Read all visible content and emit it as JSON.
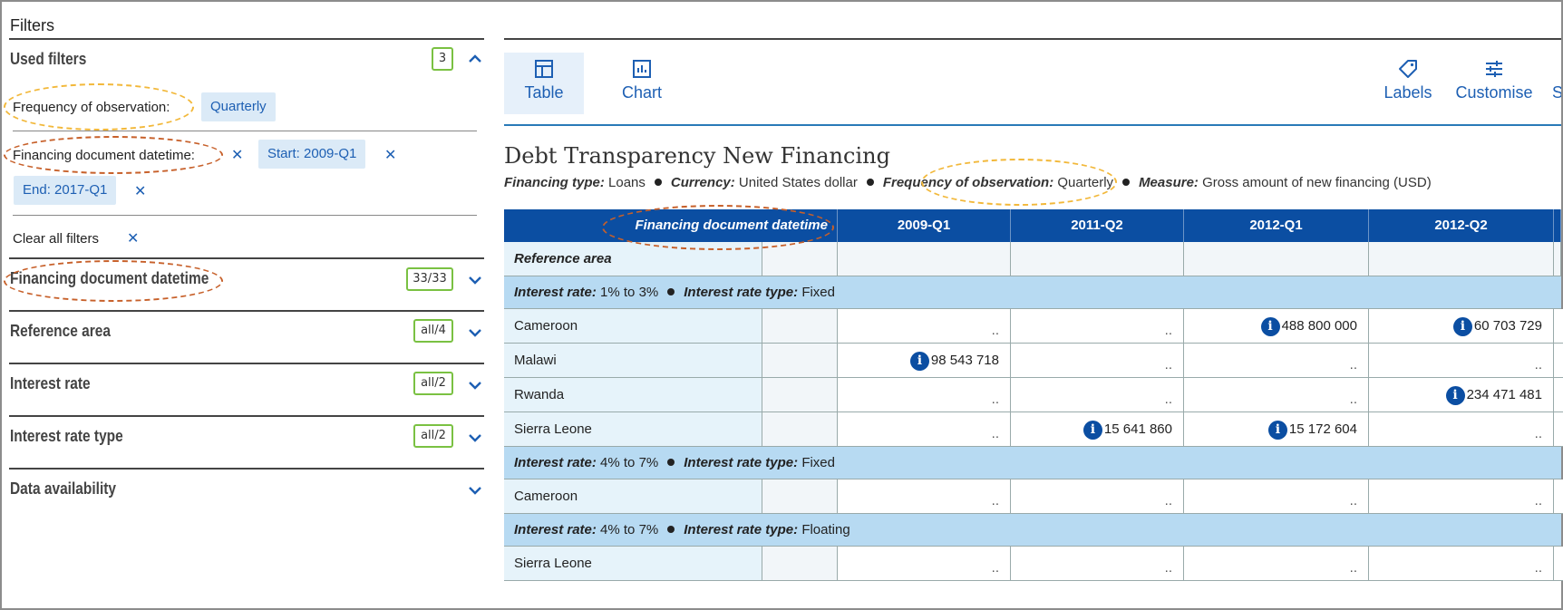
{
  "filters": {
    "title": "Filters",
    "used_filters": {
      "label": "Used filters",
      "count": "3"
    },
    "frequency": {
      "label": "Frequency of observation:",
      "chip": "Quarterly"
    },
    "datetime": {
      "label": "Financing document datetime:",
      "start_chip": "Start: 2009-Q1",
      "end_chip": "End: 2017-Q1"
    },
    "clear_all": "Clear all filters",
    "sections": [
      {
        "label": "Financing document datetime",
        "badge": "33/33"
      },
      {
        "label": "Reference area",
        "badge": "all/4"
      },
      {
        "label": "Interest rate",
        "badge": "all/2"
      },
      {
        "label": "Interest rate type",
        "badge": "all/2"
      },
      {
        "label": "Data availability",
        "badge": ""
      }
    ]
  },
  "toolbar": {
    "table": "Table",
    "chart": "Chart",
    "labels": "Labels",
    "customise": "Customise",
    "share_partial": "S"
  },
  "doc": {
    "title": "Debt Transparency New Financing",
    "subtitle": [
      {
        "key": "Financing type:",
        "value": "Loans"
      },
      {
        "key": "Currency:",
        "value": "United States dollar"
      },
      {
        "key": "Frequency of observation:",
        "value": "Quarterly"
      },
      {
        "key": "Measure:",
        "value": "Gross amount of new financing (USD)"
      }
    ]
  },
  "table": {
    "dim_header": "Financing document datetime",
    "row_dim_label": "Reference area",
    "columns": [
      "2009-Q1",
      "2011-Q2",
      "2012-Q1",
      "2012-Q2"
    ],
    "groups": [
      {
        "rate_key": "Interest rate:",
        "rate": "1% to 3%",
        "type_key": "Interest rate type:",
        "type": "Fixed",
        "rows": [
          {
            "area": "Cameroon",
            "values": [
              "..",
              "..",
              "488 800 000",
              "60 703 729"
            ],
            "info": [
              false,
              false,
              true,
              true
            ]
          },
          {
            "area": "Malawi",
            "values": [
              "98 543 718",
              "..",
              "..",
              ".."
            ],
            "info": [
              true,
              false,
              false,
              false
            ]
          },
          {
            "area": "Rwanda",
            "values": [
              "..",
              "..",
              "..",
              "234 471 481"
            ],
            "info": [
              false,
              false,
              false,
              true
            ]
          },
          {
            "area": "Sierra Leone",
            "values": [
              "..",
              "15 641 860",
              "15 172 604",
              ".."
            ],
            "info": [
              false,
              true,
              true,
              false
            ]
          }
        ]
      },
      {
        "rate_key": "Interest rate:",
        "rate": "4% to 7%",
        "type_key": "Interest rate type:",
        "type": "Fixed",
        "rows": [
          {
            "area": "Cameroon",
            "values": [
              "..",
              "..",
              "..",
              ".."
            ],
            "info": [
              false,
              false,
              false,
              false
            ]
          }
        ]
      },
      {
        "rate_key": "Interest rate:",
        "rate": "4% to 7%",
        "type_key": "Interest rate type:",
        "type": "Floating",
        "rows": [
          {
            "area": "Sierra Leone",
            "values": [
              "..",
              "..",
              "..",
              ".."
            ],
            "info": [
              false,
              false,
              false,
              false
            ]
          }
        ]
      }
    ]
  }
}
